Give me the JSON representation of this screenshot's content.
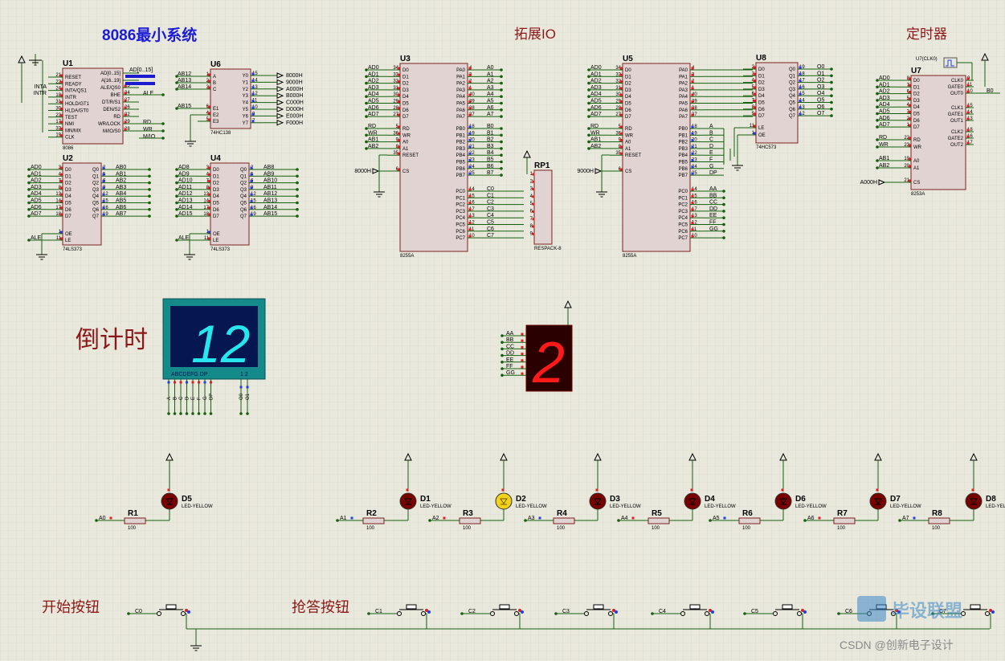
{
  "titles": {
    "main": "8086最小系统",
    "io": "拓展IO",
    "timer": "定时器",
    "countdown": "倒计时",
    "start_button": "开始按钮",
    "answer_button": "抢答按钮"
  },
  "watermark": {
    "logo_text": "毕设联盟",
    "credit": "CSDN @创新电子设计"
  },
  "u1": {
    "ref": "U1",
    "part": "8086",
    "left_pins": [
      [
        "21",
        "RESET"
      ],
      [
        "22",
        "READY"
      ],
      [
        "24",
        "INTA/QS1"
      ],
      [
        "18",
        "INTR"
      ],
      [
        "31",
        "HOLD/GT1"
      ],
      [
        "30",
        "HLDA/GT0"
      ],
      [
        "23",
        "TEST"
      ],
      [
        "17",
        "NMI"
      ],
      [
        "33",
        "MN/MX"
      ],
      [
        "19",
        "CLK"
      ]
    ],
    "right_pins": [
      [
        "",
        "AD[0..15]"
      ],
      [
        "",
        "A[16..19]"
      ],
      [
        "25",
        "ALE/QS0"
      ],
      [
        "34",
        "BHE"
      ],
      [
        "27",
        "DT/R/S1"
      ],
      [
        "26",
        "DEN/S2"
      ],
      [
        "32",
        "RD"
      ],
      [
        "29",
        "WR/LOCK"
      ],
      [
        "28",
        "M/IO/S0"
      ]
    ],
    "left_nets": [
      "INTA",
      "INTR"
    ],
    "right_nets": [
      "AD[0..15]",
      "ALE",
      "RD",
      "WR",
      "M/IO"
    ]
  },
  "u6": {
    "ref": "U6",
    "part": "74HC138",
    "left_pins": [
      [
        "1",
        "A"
      ],
      [
        "2",
        "B"
      ],
      [
        "3",
        "C"
      ],
      [
        "6",
        "E1"
      ],
      [
        "4",
        "E2"
      ],
      [
        "5",
        "E3"
      ]
    ],
    "left_nets": [
      "AB12",
      "AB13",
      "AB14",
      "AB15"
    ],
    "right_pins": [
      [
        "15",
        "Y0"
      ],
      [
        "14",
        "Y1"
      ],
      [
        "13",
        "Y2"
      ],
      [
        "12",
        "Y3"
      ],
      [
        "11",
        "Y4"
      ],
      [
        "10",
        "Y5"
      ],
      [
        "9",
        "Y6"
      ],
      [
        "7",
        "Y7"
      ]
    ],
    "outputs": [
      "8000H",
      "9000H",
      "A000H",
      "B000H",
      "C000H",
      "D000H",
      "E000H",
      "F000H"
    ]
  },
  "u2": {
    "ref": "U2",
    "part": "74LS373",
    "in_nets": [
      "AD0",
      "AD1",
      "AD2",
      "AD3",
      "AD4",
      "AD5",
      "AD6",
      "AD7"
    ],
    "in_nums": [
      "3",
      "4",
      "7",
      "8",
      "13",
      "14",
      "17",
      "18"
    ],
    "out_nums": [
      "2",
      "5",
      "6",
      "9",
      "12",
      "15",
      "16",
      "19"
    ],
    "out_nets": [
      "AB0",
      "AB1",
      "AB2",
      "AB3",
      "AB4",
      "AB5",
      "AB6",
      "AB7"
    ],
    "d_pins": [
      "D0",
      "D1",
      "D2",
      "D3",
      "D4",
      "D5",
      "D6",
      "D7"
    ],
    "q_pins": [
      "Q0",
      "Q1",
      "Q2",
      "Q3",
      "Q4",
      "Q5",
      "Q6",
      "Q7"
    ],
    "oe": "OE",
    "le": "LE",
    "le_net": "ALE",
    "oe_num": "1",
    "le_num": "11"
  },
  "u4": {
    "ref": "U4",
    "part": "74LS373",
    "in_nets": [
      "AD8",
      "AD9",
      "AD10",
      "AD11",
      "AD12",
      "AD13",
      "AD14",
      "AD15"
    ],
    "in_nums": [
      "3",
      "4",
      "7",
      "8",
      "13",
      "14",
      "17",
      "18"
    ],
    "out_nums": [
      "2",
      "5",
      "6",
      "9",
      "12",
      "15",
      "16",
      "19"
    ],
    "out_nets": [
      "AB8",
      "AB9",
      "AB10",
      "AB11",
      "AB12",
      "AB13",
      "AB14",
      "AB15"
    ],
    "d_pins": [
      "D0",
      "D1",
      "D2",
      "D3",
      "D4",
      "D5",
      "D6",
      "D7"
    ],
    "q_pins": [
      "Q0",
      "Q1",
      "Q2",
      "Q3",
      "Q4",
      "Q5",
      "Q6",
      "Q7"
    ],
    "oe": "OE",
    "le": "LE",
    "le_net": "ALE",
    "oe_num": "1",
    "le_num": "11"
  },
  "u3": {
    "ref": "U3",
    "part": "8255A",
    "cs_net": "8000H",
    "left_nets": [
      "AD0",
      "AD1",
      "AD2",
      "AD3",
      "AD4",
      "AD5",
      "AD6",
      "AD7"
    ],
    "left_nums": [
      "34",
      "33",
      "32",
      "31",
      "30",
      "29",
      "28",
      "27"
    ],
    "left_pins": [
      "D0",
      "D1",
      "D2",
      "D3",
      "D4",
      "D5",
      "D6",
      "D7"
    ],
    "ctrl_nets": [
      "RD",
      "WR",
      "AB1",
      "AB2",
      ""
    ],
    "ctrl_nums": [
      "5",
      "36",
      "9",
      "8",
      "35"
    ],
    "ctrl_pins": [
      "RD",
      "WR",
      "A0",
      "A1",
      "RESET"
    ],
    "cs_num": "6",
    "cs_pin": "CS",
    "pa_pins": [
      "PA0",
      "PA1",
      "PA2",
      "PA3",
      "PA4",
      "PA5",
      "PA6",
      "PA7"
    ],
    "pa_nums": [
      "4",
      "3",
      "2",
      "1",
      "40",
      "39",
      "38",
      "37"
    ],
    "pa_nets": [
      "A0",
      "A1",
      "A2",
      "A3",
      "A4",
      "A5",
      "A6",
      "A7"
    ],
    "pb_pins": [
      "PB0",
      "PB1",
      "PB2",
      "PB3",
      "PB4",
      "PB5",
      "PB6",
      "PB7"
    ],
    "pb_nums": [
      "18",
      "19",
      "20",
      "21",
      "22",
      "23",
      "24",
      "25"
    ],
    "pb_nets": [
      "B0",
      "B1",
      "B2",
      "B3",
      "B4",
      "B5",
      "B6",
      "B7"
    ],
    "pc_pins": [
      "PC0",
      "PC1",
      "PC2",
      "PC3",
      "PC4",
      "PC5",
      "PC6",
      "PC7"
    ],
    "pc_nums": [
      "14",
      "15",
      "16",
      "17",
      "13",
      "12",
      "11",
      "10"
    ],
    "pc_nets": [
      "C0",
      "C1",
      "C2",
      "C3",
      "C4",
      "C5",
      "C6",
      "C7"
    ]
  },
  "rp1": {
    "ref": "RP1",
    "part": "RESPACK-8",
    "pins": [
      "1",
      "2",
      "3",
      "4",
      "5",
      "6",
      "7",
      "8",
      "9"
    ]
  },
  "u5": {
    "ref": "U5",
    "part": "8255A",
    "cs_net": "9000H",
    "left_nets": [
      "AD0",
      "AD1",
      "AD2",
      "AD3",
      "AD4",
      "AD5",
      "AD6",
      "AD7"
    ],
    "left_nums": [
      "34",
      "33",
      "32",
      "31",
      "30",
      "29",
      "28",
      "27"
    ],
    "left_pins": [
      "D0",
      "D1",
      "D2",
      "D3",
      "D4",
      "D5",
      "D6",
      "D7"
    ],
    "ctrl_nets": [
      "RD",
      "WR",
      "AB1",
      "AB2",
      ""
    ],
    "ctrl_nums": [
      "5",
      "36",
      "9",
      "8",
      "35"
    ],
    "ctrl_pins": [
      "RD",
      "WR",
      "A0",
      "A1",
      "RESET"
    ],
    "cs_num": "6",
    "cs_pin": "CS",
    "pa_pins": [
      "PA0",
      "PA1",
      "PA2",
      "PA3",
      "PA4",
      "PA5",
      "PA6",
      "PA7"
    ],
    "pa_nums": [
      "4",
      "3",
      "2",
      "1",
      "40",
      "39",
      "38",
      "37"
    ],
    "pb_pins": [
      "PB0",
      "PB1",
      "PB2",
      "PB3",
      "PB4",
      "PB5",
      "PB6",
      "PB7"
    ],
    "pb_nums": [
      "18",
      "19",
      "20",
      "21",
      "22",
      "23",
      "24",
      "25"
    ],
    "pb_nets": [
      "A",
      "B",
      "C",
      "D",
      "E",
      "F",
      "G",
      "DP"
    ],
    "pc_pins": [
      "PC0",
      "PC1",
      "PC2",
      "PC3",
      "PC4",
      "PC5",
      "PC6",
      "PC7"
    ],
    "pc_nums": [
      "14",
      "15",
      "16",
      "17",
      "13",
      "12",
      "11",
      "10"
    ],
    "pc_nets": [
      "AA",
      "BB",
      "CC",
      "DD",
      "EE",
      "FF",
      "GG",
      ""
    ]
  },
  "u8": {
    "ref": "U8",
    "part": "74HC573",
    "d_pins": [
      "D0",
      "D1",
      "D2",
      "D3",
      "D4",
      "D5",
      "D6",
      "D7"
    ],
    "d_nums": [
      "2",
      "3",
      "4",
      "5",
      "6",
      "7",
      "8",
      "9"
    ],
    "q_pins": [
      "Q0",
      "Q1",
      "Q2",
      "Q3",
      "Q4",
      "Q5",
      "Q6",
      "Q7"
    ],
    "q_nums": [
      "19",
      "18",
      "17",
      "16",
      "15",
      "14",
      "13",
      "12"
    ],
    "out_nets": [
      "O0",
      "O1",
      "O2",
      "O3",
      "O4",
      "O5",
      "O6",
      "O7"
    ],
    "le": "LE",
    "oe": "OE",
    "le_num": "11",
    "oe_num": "1"
  },
  "u7": {
    "ref": "U7",
    "part": "8253A",
    "clk_label": "U7(CLK0)",
    "left_nets": [
      "AD0",
      "AD1",
      "AD2",
      "AD3",
      "AD4",
      "AD5",
      "AD6",
      "AD7"
    ],
    "left_nums": [
      "8",
      "7",
      "6",
      "5",
      "4",
      "3",
      "2",
      "1"
    ],
    "left_pins": [
      "D0",
      "D1",
      "D2",
      "D3",
      "D4",
      "D5",
      "D6",
      "D7"
    ],
    "ctrl_nets": [
      "RD",
      "WR"
    ],
    "ctrl_nums": [
      "22",
      "23"
    ],
    "ctrl_pins": [
      "RD",
      "WR"
    ],
    "addr_nets": [
      "AB1",
      "AB2"
    ],
    "addr_nums": [
      "19",
      "20"
    ],
    "addr_pins": [
      "A0",
      "A1"
    ],
    "cs_net": "A000H",
    "cs_num": "21",
    "cs_pin": "CS",
    "right_pins": [
      "CLK0",
      "GATE0",
      "OUT0",
      "CLK1",
      "GATE1",
      "OUT1",
      "CLK2",
      "GATE2",
      "OUT2"
    ],
    "right_nums": [
      "9",
      "11",
      "10",
      "15",
      "14",
      "13",
      "18",
      "16",
      "17"
    ],
    "out_net": "B0"
  },
  "display_big": {
    "value": "12",
    "seg_label": "ABCDEFG DP",
    "digit_label": "1 2",
    "pins": [
      "A",
      "B",
      "C",
      "D",
      "E",
      "F",
      "G",
      "DP"
    ],
    "digit_pins": [
      "O0",
      "O1"
    ]
  },
  "display_red": {
    "value": "2",
    "pins": [
      "AA",
      "BB",
      "CC",
      "DD",
      "EE",
      "FF",
      "GG"
    ]
  },
  "leds": [
    {
      "ref": "D5",
      "part": "LED-YELLOW",
      "res": "R1",
      "val": "100",
      "net": "A0",
      "lit": false
    },
    {
      "ref": "D1",
      "part": "LED-YELLOW",
      "res": "R2",
      "val": "100",
      "net": "A1",
      "lit": false
    },
    {
      "ref": "D2",
      "part": "LED-YELLOW",
      "res": "R3",
      "val": "100",
      "net": "A2",
      "lit": true
    },
    {
      "ref": "D3",
      "part": "LED-YELLOW",
      "res": "R4",
      "val": "100",
      "net": "A3",
      "lit": false
    },
    {
      "ref": "D4",
      "part": "LED-YELLOW",
      "res": "R5",
      "val": "100",
      "net": "A4",
      "lit": false
    },
    {
      "ref": "D6",
      "part": "LED-YELLOW",
      "res": "R6",
      "val": "100",
      "net": "A5",
      "lit": false
    },
    {
      "ref": "D7",
      "part": "LED-YELLOW",
      "res": "R7",
      "val": "100",
      "net": "A6",
      "lit": false
    },
    {
      "ref": "D8",
      "part": "LED-YELLOW",
      "res": "R8",
      "val": "100",
      "net": "A7",
      "lit": false
    }
  ],
  "buttons": [
    "C0",
    "C1",
    "C2",
    "C3",
    "C4",
    "C5",
    "C6",
    "C7"
  ],
  "colors": {
    "background": "#e9e8dc",
    "grid": "#d4d3c6",
    "chip_fill": "#e2d3d3",
    "chip_border": "#7a2020",
    "wire": "#15600e",
    "title_blue": "#1b1bd6",
    "title_red": "#8a1818",
    "led_red": "#7a0000",
    "led_lit": "#f3d21b",
    "seg_cyan": "#27e6ee",
    "seg_red": "#ff1a1a"
  }
}
